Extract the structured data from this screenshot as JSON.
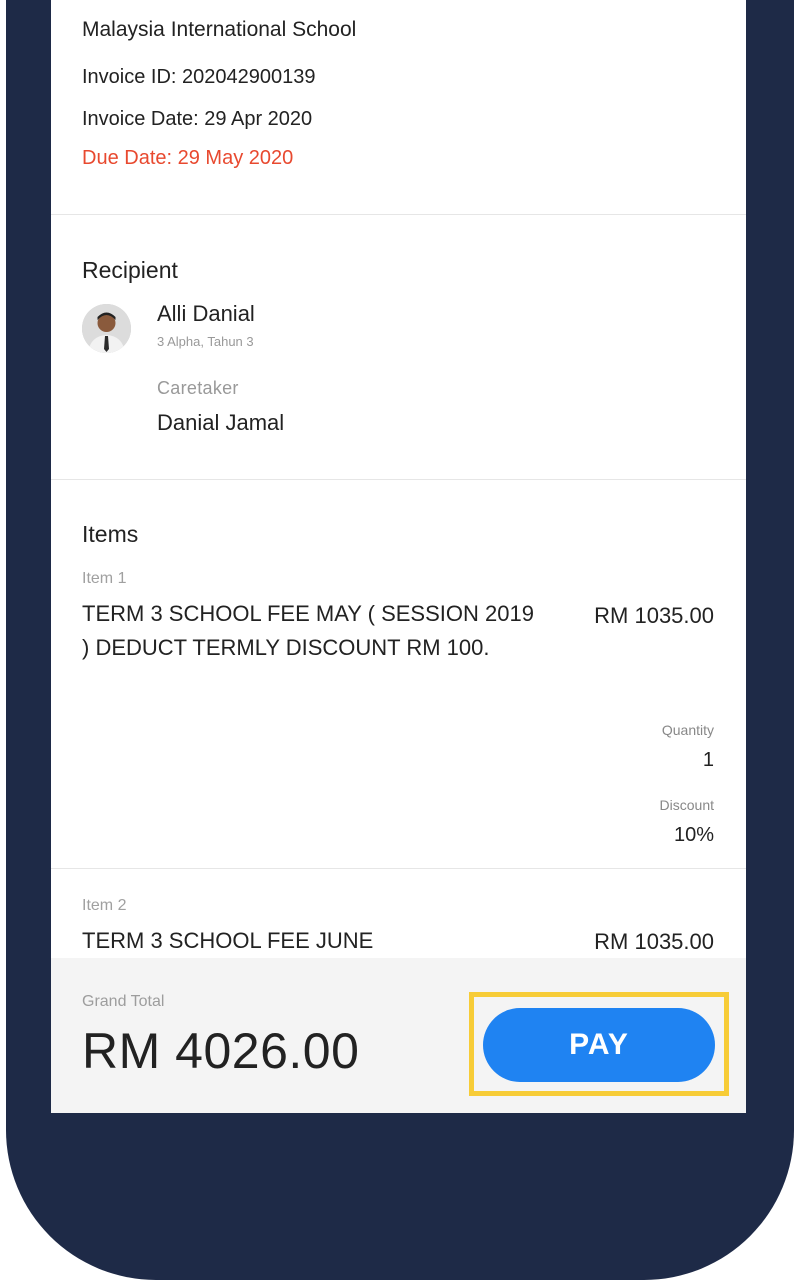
{
  "invoice": {
    "school": "Malaysia International School",
    "id_line": "Invoice ID: 202042900139",
    "date_line": "Invoice Date: 29 Apr 2020",
    "due_line": "Due Date: 29 May 2020"
  },
  "recipient": {
    "title": "Recipient",
    "name": "Alli Danial",
    "class": "3 Alpha, Tahun 3",
    "caretaker_label": "Caretaker",
    "caretaker_name": "Danial Jamal"
  },
  "items": {
    "title": "Items",
    "list": [
      {
        "label": "Item 1",
        "description": "TERM 3 SCHOOL FEE MAY ( SESSION 2019 ) DEDUCT TERMLY DISCOUNT RM 100.",
        "price": "RM 1035.00",
        "quantity_label": "Quantity",
        "quantity": "1",
        "discount_label": "Discount",
        "discount": "10%"
      },
      {
        "label": "Item 2",
        "description": "TERM 3 SCHOOL FEE JUNE",
        "price": "RM 1035.00"
      }
    ]
  },
  "footer": {
    "grand_total_label": "Grand Total",
    "grand_total": "RM 4026.00",
    "pay_label": "PAY"
  },
  "colors": {
    "accent": "#1f83f2",
    "due": "#e8492f",
    "highlight": "#f7cc37",
    "frame": "#1e2a47"
  }
}
